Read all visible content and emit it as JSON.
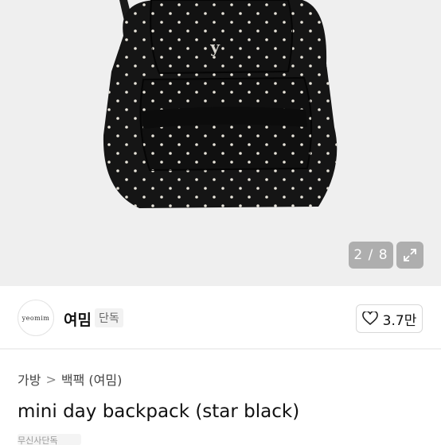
{
  "gallery": {
    "counter": "2 / 8",
    "logo_letter": "y"
  },
  "seller": {
    "avatar_text": "yeomim",
    "name": "여밈",
    "badge": "단독"
  },
  "like": {
    "count": "3.7만"
  },
  "breadcrumb": {
    "category": "가방",
    "separator": ">",
    "subcategory": "백팩 (여밈)"
  },
  "product": {
    "title": "mini day backpack (star black)",
    "tag": "무신사단독"
  },
  "colors": {
    "bag": "#151515",
    "dot": "#e8e4da",
    "hero_bg": "#efefef"
  }
}
